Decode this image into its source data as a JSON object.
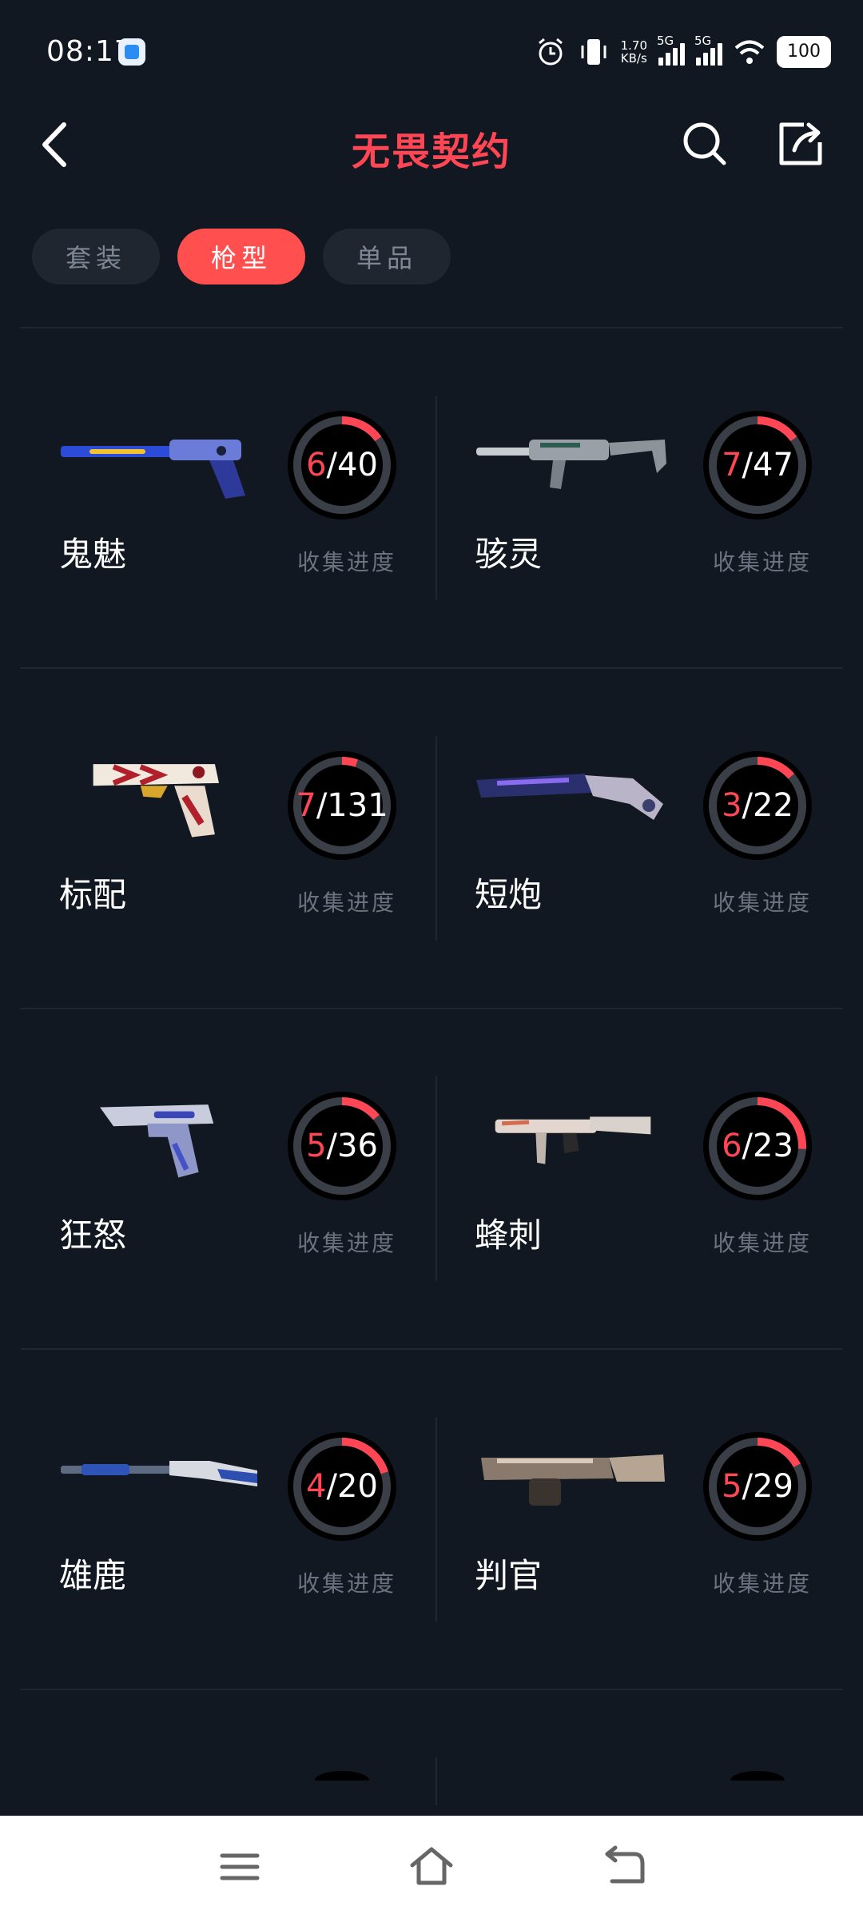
{
  "status": {
    "time": "08:17",
    "net_speed": "1.70",
    "net_unit": "KB/s",
    "sim1": "5G",
    "sim2": "5G",
    "battery": "100"
  },
  "header": {
    "title": "无畏契约"
  },
  "tabs": [
    {
      "label": "套装",
      "active": false
    },
    {
      "label": "枪型",
      "active": true
    },
    {
      "label": "单品",
      "active": false
    }
  ],
  "progress_label": "收集进度",
  "weapons": [
    {
      "name": "鬼魅",
      "collected": "6",
      "total": "/40",
      "progress": 0.15
    },
    {
      "name": "骇灵",
      "collected": "7",
      "total": "/47",
      "progress": 0.15
    },
    {
      "name": "标配",
      "collected": "7",
      "total": "/131",
      "progress": 0.053
    },
    {
      "name": "短炮",
      "collected": "3",
      "total": "/22",
      "progress": 0.136
    },
    {
      "name": "狂怒",
      "collected": "5",
      "total": "/36",
      "progress": 0.139
    },
    {
      "name": "蜂刺",
      "collected": "6",
      "total": "/23",
      "progress": 0.26
    },
    {
      "name": "雄鹿",
      "collected": "4",
      "total": "/20",
      "progress": 0.2
    },
    {
      "name": "判官",
      "collected": "5",
      "total": "/29",
      "progress": 0.172
    }
  ],
  "colors": {
    "accent": "#ff4655",
    "ring_track": "#3a3f47",
    "background": "#111821"
  }
}
